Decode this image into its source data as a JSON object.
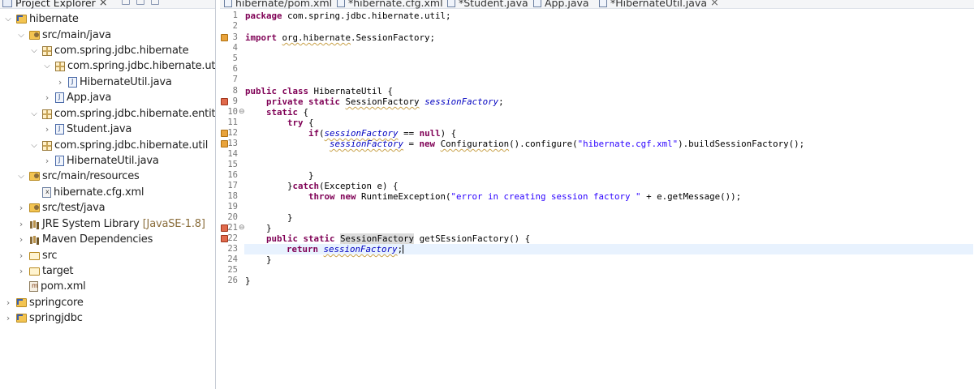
{
  "explorer": {
    "title": "Project Explorer",
    "tree": [
      {
        "label": "hibernate",
        "icon": "project-icon",
        "expanded": true
      },
      {
        "label": "src/main/java",
        "icon": "source-folder-icon",
        "expanded": true
      },
      {
        "label": "com.spring.jdbc.hibernate",
        "icon": "package-icon",
        "expanded": true
      },
      {
        "label": "com.spring.jdbc.hibernate.util",
        "icon": "package-icon",
        "expanded": true
      },
      {
        "label": "HibernateUtil.java",
        "icon": "java-file-icon",
        "expanded": false
      },
      {
        "label": "App.java",
        "icon": "java-file-icon",
        "expanded": false
      },
      {
        "label": "com.spring.jdbc.hibernate.entities",
        "icon": "package-icon",
        "expanded": true
      },
      {
        "label": "Student.java",
        "icon": "java-file-icon",
        "expanded": false
      },
      {
        "label": "com.spring.jdbc.hibernate.util",
        "icon": "package-icon",
        "expanded": true
      },
      {
        "label": "HibernateUtil.java",
        "icon": "java-file-icon",
        "expanded": false
      },
      {
        "label": "src/main/resources",
        "icon": "source-folder-icon",
        "expanded": true
      },
      {
        "label": "hibernate.cfg.xml",
        "icon": "xml-file-icon"
      },
      {
        "label": "src/test/java",
        "icon": "source-folder-icon",
        "expanded": false
      },
      {
        "label": "JRE System Library",
        "suffix": "[JavaSE-1.8]",
        "icon": "library-icon",
        "expanded": false
      },
      {
        "label": "Maven Dependencies",
        "icon": "library-icon",
        "expanded": false
      },
      {
        "label": "src",
        "icon": "folder-icon",
        "expanded": false
      },
      {
        "label": "target",
        "icon": "folder-icon",
        "expanded": false
      },
      {
        "label": "pom.xml",
        "icon": "maven-file-icon"
      },
      {
        "label": "springcore",
        "icon": "project-icon",
        "expanded": false
      },
      {
        "label": "springjdbc",
        "icon": "project-icon",
        "expanded": false
      }
    ]
  },
  "editor": {
    "tabs": [
      {
        "label": "hibernate/pom.xml",
        "icon": "maven-file-icon"
      },
      {
        "label": "*hibernate.cfg.xml",
        "icon": "xml-file-icon"
      },
      {
        "label": "*Student.java",
        "icon": "java-file-icon"
      },
      {
        "label": "App.java",
        "icon": "java-file-icon"
      },
      {
        "label": "*HibernateUtil.java",
        "icon": "java-file-icon",
        "active": true
      }
    ],
    "line_numbers": [
      "1",
      "2",
      "3",
      "4",
      "5",
      "6",
      "7",
      "8",
      "9",
      "10",
      "11",
      "12",
      "13",
      "14",
      "15",
      "16",
      "17",
      "18",
      "19",
      "20",
      "21",
      "22",
      "23",
      "24",
      "25",
      "26"
    ],
    "code": {
      "l1_kw": "package",
      "l1_rest": " com.spring.jdbc.hibernate.util;",
      "l3_kw": "import",
      "l3_pkg": "org.hibernate",
      "l3_rest": ".SessionFactory;",
      "l8_kw": "public class",
      "l8_rest": " HibernateUtil {",
      "l9_kw": "private static",
      "l9_type": "SessionFactory",
      "l9_field": "sessionFactory",
      "l9_end": ";",
      "l10_kw": "static",
      "l10_rest": " {",
      "l11_kw": "try",
      "l11_rest": " {",
      "l12_kw": "if",
      "l12_open": "(",
      "l12_field": "sessionFactory",
      "l12_mid": " == ",
      "l12_null": "null",
      "l12_end": ") {",
      "l13_field": "sessionFactory",
      "l13_eq": " = ",
      "l13_new": "new",
      "l13_cls": "Configuration",
      "l13_mid": "().configure(",
      "l13_str": "\"hibernate.cgf.xml\"",
      "l13_end": ").buildSessionFactory();",
      "l15_rest": "}",
      "l16_open": "}",
      "l16_kw": "catch",
      "l16_rest": "(Exception e) {",
      "l17_kw": "throw new",
      "l17_mid": " RuntimeException(",
      "l17_str": "\"error in creating session factory \"",
      "l17_end": " + e.getMessage());",
      "l19_rest": "}",
      "l20_rest": "}",
      "l21_kw": "public static",
      "l21_type": "SessionFactory",
      "l21_rest": " getSEssionFactory() {",
      "l22_kw": "return",
      "l22_field": "sessionFactory",
      "l22_end": ";",
      "l23_rest": "}",
      "l25_rest": "}"
    }
  },
  "colors": {
    "keyword": "#7f0055",
    "string": "#2a00ff",
    "field": "#0000c0",
    "current_line": "#e8f2fe"
  }
}
